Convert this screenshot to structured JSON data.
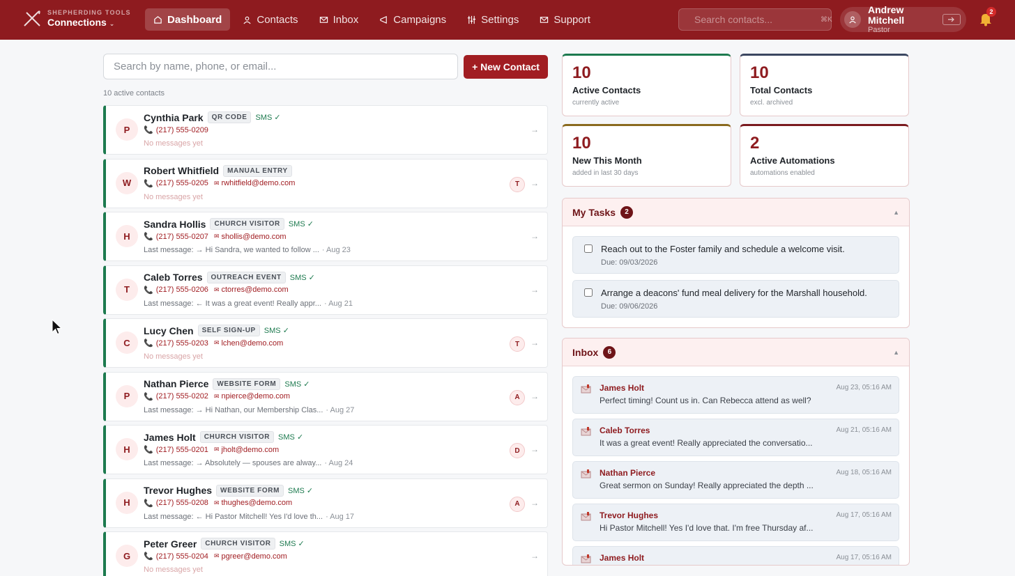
{
  "brand": {
    "subtitle": "SHEPHERDING TOOLS",
    "title": "Connections",
    "caret": "⌄"
  },
  "nav": {
    "items": [
      {
        "label": "Dashboard"
      },
      {
        "label": "Contacts"
      },
      {
        "label": "Inbox"
      },
      {
        "label": "Campaigns"
      },
      {
        "label": "Settings"
      },
      {
        "label": "Support"
      }
    ]
  },
  "top_search": {
    "placeholder": "Search contacts...",
    "shortcut": "⌘K"
  },
  "user": {
    "name": "Andrew Mitchell",
    "role": "Pastor"
  },
  "notifications": {
    "count": "2"
  },
  "contacts_panel": {
    "search_placeholder": "Search by name, phone, or email...",
    "new_button": "+ New Contact",
    "active_count": "10 active contacts",
    "contacts": [
      {
        "initial": "P",
        "name": "Cynthia Park",
        "tag": "QR CODE",
        "sms": "SMS ✓",
        "phone": "(217) 555-0209",
        "email": "",
        "message": "No messages yet",
        "date": "",
        "assignee": ""
      },
      {
        "initial": "W",
        "name": "Robert Whitfield",
        "tag": "MANUAL ENTRY",
        "sms": "",
        "phone": "(217) 555-0205",
        "email": "rwhitfield@demo.com",
        "message": "No messages yet",
        "date": "",
        "assignee": "T"
      },
      {
        "initial": "H",
        "name": "Sandra Hollis",
        "tag": "CHURCH VISITOR",
        "sms": "SMS ✓",
        "phone": "(217) 555-0207",
        "email": "shollis@demo.com",
        "message": "Last message: → Hi Sandra, we wanted to follow ...",
        "date": "· Aug 23",
        "assignee": ""
      },
      {
        "initial": "T",
        "name": "Caleb Torres",
        "tag": "OUTREACH EVENT",
        "sms": "SMS ✓",
        "phone": "(217) 555-0206",
        "email": "ctorres@demo.com",
        "message": "Last message: ← It was a great event! Really appr...",
        "date": "· Aug 21",
        "assignee": ""
      },
      {
        "initial": "C",
        "name": "Lucy Chen",
        "tag": "SELF SIGN-UP",
        "sms": "SMS ✓",
        "phone": "(217) 555-0203",
        "email": "lchen@demo.com",
        "message": "No messages yet",
        "date": "",
        "assignee": "T"
      },
      {
        "initial": "P",
        "name": "Nathan Pierce",
        "tag": "WEBSITE FORM",
        "sms": "SMS ✓",
        "phone": "(217) 555-0202",
        "email": "npierce@demo.com",
        "message": "Last message: → Hi Nathan, our Membership Clas...",
        "date": "· Aug 27",
        "assignee": "A"
      },
      {
        "initial": "H",
        "name": "James Holt",
        "tag": "CHURCH VISITOR",
        "sms": "SMS ✓",
        "phone": "(217) 555-0201",
        "email": "jholt@demo.com",
        "message": "Last message: → Absolutely — spouses are alway...",
        "date": "· Aug 24",
        "assignee": "D"
      },
      {
        "initial": "H",
        "name": "Trevor Hughes",
        "tag": "WEBSITE FORM",
        "sms": "SMS ✓",
        "phone": "(217) 555-0208",
        "email": "thughes@demo.com",
        "message": "Last message: ← Hi Pastor Mitchell! Yes I'd love th...",
        "date": "· Aug 17",
        "assignee": "A"
      },
      {
        "initial": "G",
        "name": "Peter Greer",
        "tag": "CHURCH VISITOR",
        "sms": "SMS ✓",
        "phone": "(217) 555-0204",
        "email": "pgreer@demo.com",
        "message": "No messages yet",
        "date": "",
        "assignee": ""
      }
    ]
  },
  "stats": [
    {
      "value": "10",
      "label": "Active Contacts",
      "sub": "currently active",
      "accent": "#1d7a4f"
    },
    {
      "value": "10",
      "label": "Total Contacts",
      "sub": "excl. archived",
      "accent": "#3a4660"
    },
    {
      "value": "10",
      "label": "New This Month",
      "sub": "added in last 30 days",
      "accent": "#8a6a1e"
    },
    {
      "value": "2",
      "label": "Active Automations",
      "sub": "automations enabled",
      "accent": "#7a1a1e"
    }
  ],
  "tasks": {
    "title": "My Tasks",
    "count": "2",
    "toggle": "▲",
    "items": [
      {
        "text": "Reach out to the Foster family and schedule a welcome visit.",
        "due": "Due: 09/03/2026"
      },
      {
        "text": "Arrange a deacons' fund meal delivery for the Marshall household.",
        "due": "Due: 09/06/2026"
      }
    ]
  },
  "inbox": {
    "title": "Inbox",
    "count": "6",
    "toggle": "▲",
    "items": [
      {
        "from": "James Holt",
        "time": "Aug 23, 05:16 AM",
        "text": "Perfect timing! Count us in. Can Rebecca attend as well?"
      },
      {
        "from": "Caleb Torres",
        "time": "Aug 21, 05:16 AM",
        "text": "It was a great event! Really appreciated the conversatio..."
      },
      {
        "from": "Nathan Pierce",
        "time": "Aug 18, 05:16 AM",
        "text": "Great sermon on Sunday! Really appreciated the depth ..."
      },
      {
        "from": "Trevor Hughes",
        "time": "Aug 17, 05:16 AM",
        "text": "Hi Pastor Mitchell! Yes I'd love that. I'm free Thursday af..."
      },
      {
        "from": "James Holt",
        "time": "Aug 17, 05:16 AM",
        "text": ""
      }
    ]
  },
  "colors": {
    "brand": "#8e1b1f",
    "accent_green": "#1d7a4f"
  }
}
